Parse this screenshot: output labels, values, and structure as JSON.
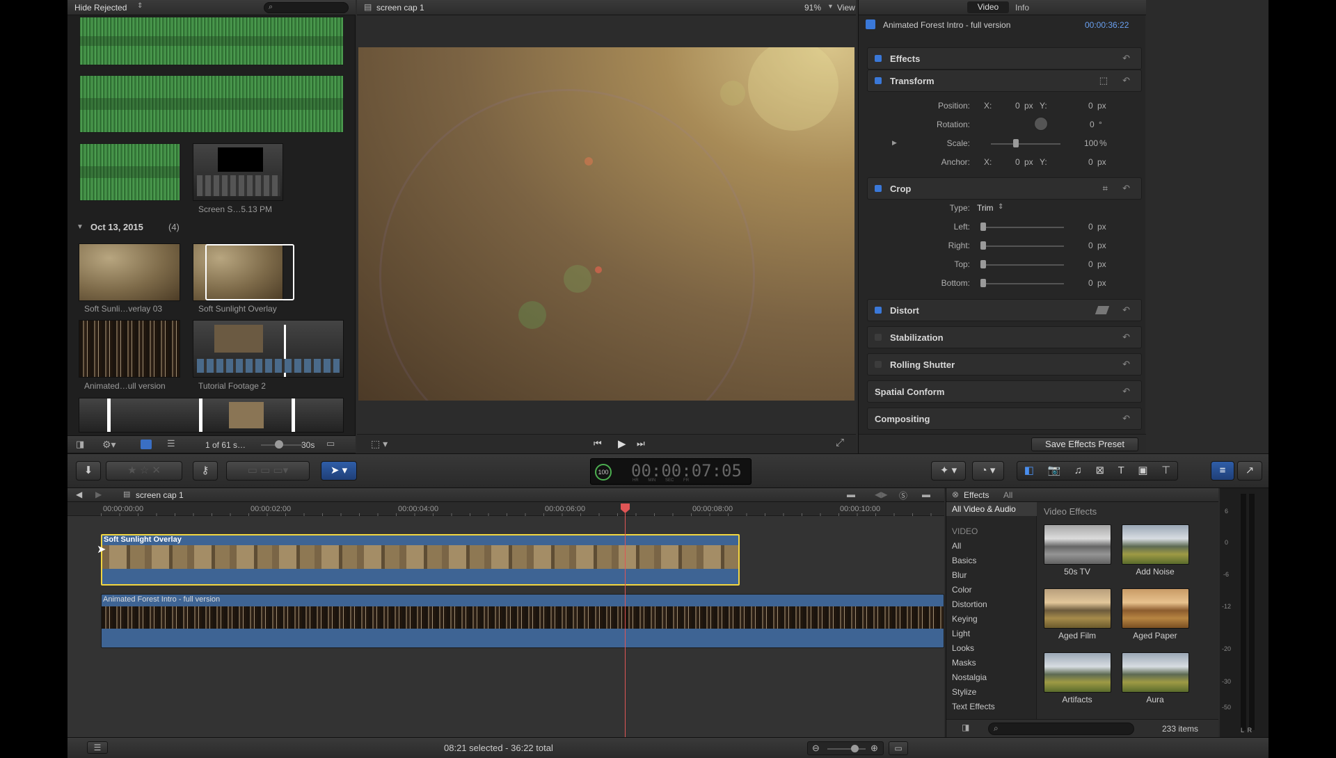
{
  "browser": {
    "filter": "Hide Rejected",
    "group_date": "Oct 13, 2015",
    "group_count": "(4)",
    "clip_screen": "Screen S…5.13 PM",
    "clip_soft03": "Soft Sunli…verlay 03",
    "clip_soft": "Soft Sunlight Overlay",
    "clip_animated": "Animated…ull version",
    "clip_tutorial": "Tutorial Footage 2",
    "count": "1 of 61 s…",
    "duration": "30s"
  },
  "viewer": {
    "title": "screen cap 1",
    "zoom": "91%",
    "view_label": "View"
  },
  "inspector": {
    "tab_video": "Video",
    "tab_info": "Info",
    "clip_name": "Animated Forest Intro - full version",
    "clip_time": "00:00:36:22",
    "effects": "Effects",
    "transform": "Transform",
    "position": "Position:",
    "x": "X:",
    "y": "Y:",
    "zero": "0",
    "px": "px",
    "rotation": "Rotation:",
    "rotation_val": "0",
    "deg": "°",
    "scale": "Scale:",
    "scale_val": "100",
    "pct": "%",
    "anchor": "Anchor:",
    "crop": "Crop",
    "type": "Type:",
    "type_val": "Trim",
    "left": "Left:",
    "right": "Right:",
    "top": "Top:",
    "bottom": "Bottom:",
    "distort": "Distort",
    "stabilization": "Stabilization",
    "rolling": "Rolling Shutter",
    "spatial": "Spatial Conform",
    "compositing": "Compositing",
    "save_preset": "Save Effects Preset"
  },
  "toolbar": {
    "timecode": "00:00:07:05",
    "speed": "100",
    "units": [
      "HR",
      "MIN",
      "SEC",
      "FR"
    ]
  },
  "timeline": {
    "project": "screen cap 1",
    "ruler": [
      "00:00:00:00",
      "00:00:02:00",
      "00:00:04:00",
      "00:00:06:00",
      "00:00:08:00",
      "00:00:10:00"
    ],
    "clip1": "Soft Sunlight Overlay",
    "clip2": "Animated Forest Intro - full version"
  },
  "effects": {
    "title": "Effects",
    "all": "All",
    "all_va": "All Video & Audio",
    "category_header": "VIDEO",
    "categories": [
      "All",
      "Basics",
      "Blur",
      "Color",
      "Distortion",
      "Keying",
      "Light",
      "Looks",
      "Masks",
      "Nostalgia",
      "Stylize",
      "Text Effects"
    ],
    "section": "Video Effects",
    "items": [
      "50s TV",
      "Add Noise",
      "Aged Film",
      "Aged Paper",
      "Artifacts",
      "Aura"
    ],
    "count": "233 items"
  },
  "meters": {
    "ticks": [
      "6",
      "0",
      "-6",
      "-12",
      "-20",
      "-30",
      "-50"
    ],
    "lr": "L  R"
  },
  "status": {
    "selection": "08:21 selected - 36:22 total"
  }
}
